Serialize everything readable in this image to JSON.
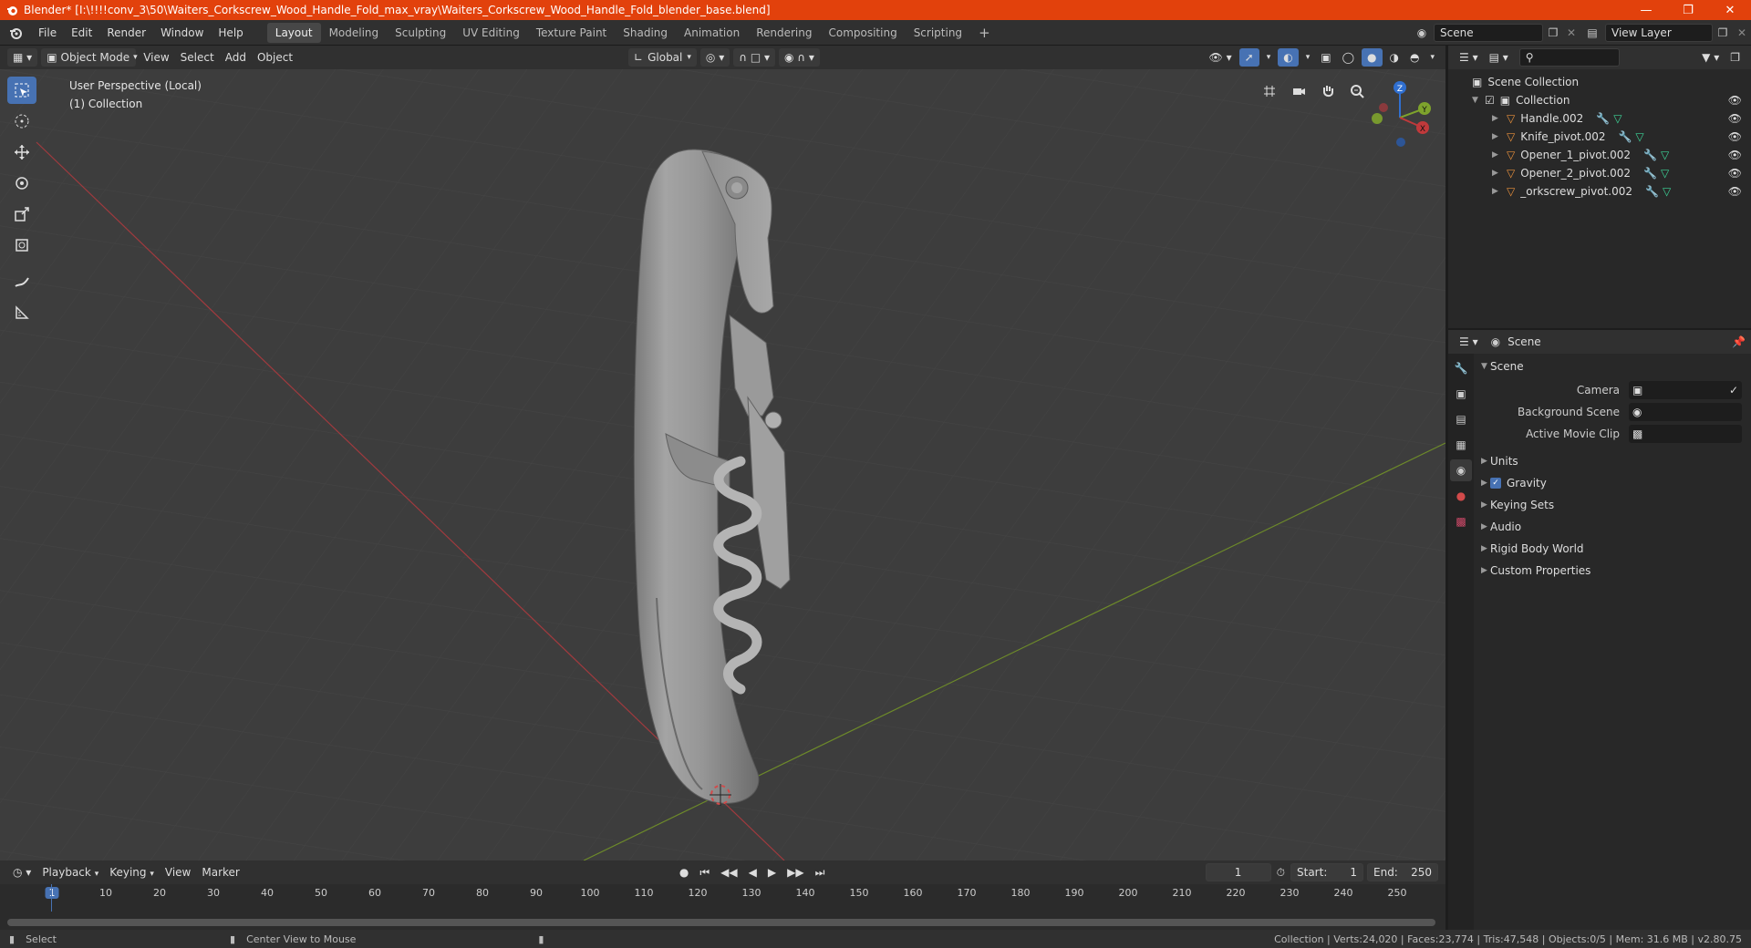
{
  "window": {
    "title": "Blender* [I:\\!!!!conv_3\\50\\Waiters_Corkscrew_Wood_Handle_Fold_max_vray\\Waiters_Corkscrew_Wood_Handle_Fold_blender_base.blend]"
  },
  "menu": [
    "File",
    "Edit",
    "Render",
    "Window",
    "Help"
  ],
  "workspaces": [
    "Layout",
    "Modeling",
    "Sculpting",
    "UV Editing",
    "Texture Paint",
    "Shading",
    "Animation",
    "Rendering",
    "Compositing",
    "Scripting"
  ],
  "scene_field": "Scene",
  "view_layer_field": "View Layer",
  "viewport_header": {
    "mode": "Object Mode",
    "menus": [
      "View",
      "Select",
      "Add",
      "Object"
    ],
    "orientation": "Global"
  },
  "viewport": {
    "perspective_label": "User Perspective (Local)",
    "collection_label": "(1) Collection",
    "gizmo_axes": {
      "z": "Z",
      "y": "Y",
      "x": "X"
    }
  },
  "outliner": {
    "root": "Scene Collection",
    "collection": "Collection",
    "objects": [
      "Handle.002",
      "Knife_pivot.002",
      "Opener_1_pivot.002",
      "Opener_2_pivot.002",
      "_orkscrew_pivot.002"
    ]
  },
  "properties": {
    "header": "Scene",
    "panel_title": "Scene",
    "camera_label": "Camera",
    "background_scene_label": "Background Scene",
    "active_movie_clip_label": "Active Movie Clip",
    "subpanels": [
      "Units",
      "Gravity",
      "Keying Sets",
      "Audio",
      "Rigid Body World",
      "Custom Properties"
    ],
    "gravity_checked": true
  },
  "timeline": {
    "menus": [
      "Playback",
      "Keying",
      "View",
      "Marker"
    ],
    "current_frame": "1",
    "start_label": "Start:",
    "start_value": "1",
    "end_label": "End:",
    "end_value": "250",
    "ticks": [
      "1",
      "10",
      "20",
      "30",
      "40",
      "50",
      "60",
      "70",
      "80",
      "90",
      "100",
      "110",
      "120",
      "130",
      "140",
      "150",
      "160",
      "170",
      "180",
      "190",
      "200",
      "210",
      "220",
      "230",
      "240",
      "250"
    ]
  },
  "statusbar": {
    "select": "Select",
    "center_view": "Center View to Mouse",
    "stats": "Collection | Verts:24,020 | Faces:23,774 | Tris:47,548 | Objects:0/5 | Mem: 31.6 MB | v2.80.75"
  },
  "colors": {
    "titlebar": "#e2410c",
    "accent": "#4772b3",
    "x_axis": "#c0393b",
    "y_axis": "#7ea32c",
    "z_axis": "#2f6fd1"
  }
}
